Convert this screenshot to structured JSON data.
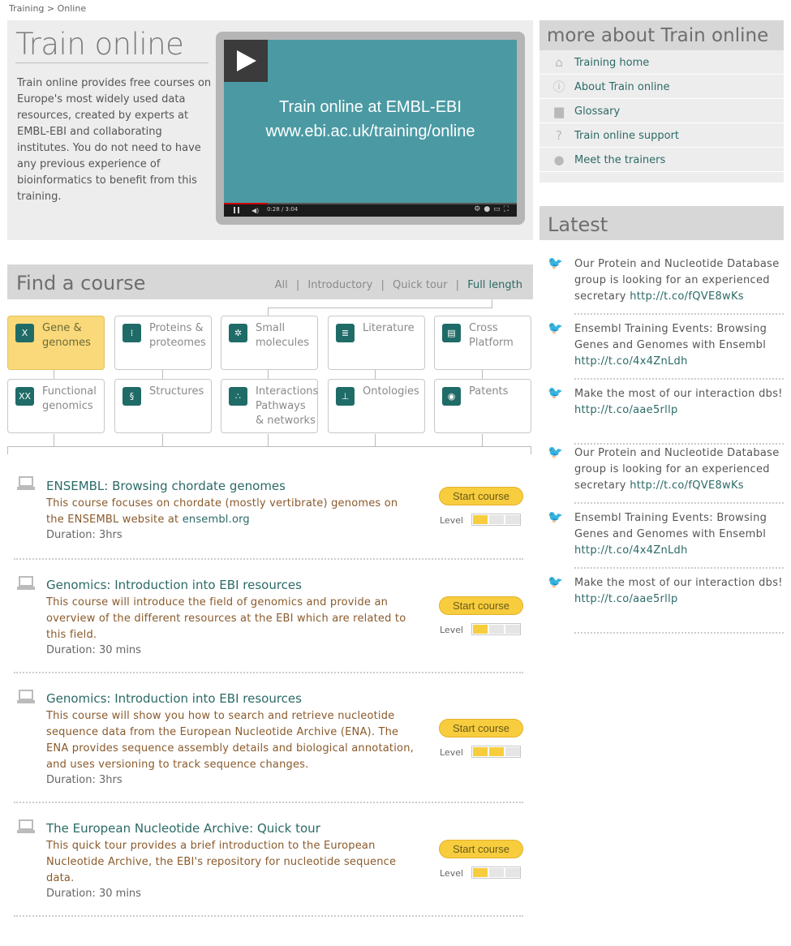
{
  "breadcrumb": {
    "part1": "Training",
    "sep": ">",
    "part2": "Online"
  },
  "hero": {
    "title": "Train online",
    "text": "Train online provides free courses on Europe's most widely used data resources, created by experts at EMBL-EBI and collaborating institutes. You do not need to have any previous experience of bioinformatics to benefit from this training.",
    "video": {
      "line1": "Train online at EMBL-EBI",
      "line2": "www.ebi.ac.uk/training/online",
      "time": "0:28 / 3:04",
      "progress": 0.15
    }
  },
  "more": {
    "title": "more about Train online",
    "items": [
      {
        "label": "Training home",
        "icon": "home-icon"
      },
      {
        "label": "About Train online",
        "icon": "info-icon"
      },
      {
        "label": "Glossary",
        "icon": "book-icon"
      },
      {
        "label": "Train online support",
        "icon": "question-icon"
      },
      {
        "label": "Meet the trainers",
        "icon": "speech-icon"
      }
    ]
  },
  "latest": {
    "title": "Latest",
    "tweets": [
      {
        "text": "Our Protein and Nucleotide Database group is looking for an experienced secretary",
        "link": "http://t.co/fQVE8wKs"
      },
      {
        "text": "Ensembl Training Events: Browsing Genes and Genomes with Ensembl",
        "link": "http://t.co/4x4ZnLdh"
      },
      {
        "text": "Make the most of our interaction dbs!",
        "link": "http://t.co/aae5rllp"
      },
      {
        "text": "Our Protein and Nucleotide Database group is looking for an experienced secretary",
        "link": "http://t.co/fQVE8wKs"
      },
      {
        "text": "Ensembl Training Events: Browsing Genes and Genomes with Ensembl",
        "link": "http://t.co/4x4ZnLdh"
      },
      {
        "text": "Make the most of our interaction dbs!",
        "link": "http://t.co/aae5rllp"
      }
    ]
  },
  "find": {
    "title": "Find a course",
    "filters": [
      "All",
      "Introductory",
      "Quick tour",
      "Full length"
    ],
    "filter_sep": "|",
    "categories": [
      {
        "label": "Gene & genomes",
        "icon": "dna-icon",
        "selected": true
      },
      {
        "label": "Proteins & proteomes",
        "icon": "protein-icon",
        "selected": false
      },
      {
        "label": "Small molecules",
        "icon": "molecule-icon",
        "selected": false
      },
      {
        "label": "Literature",
        "icon": "document-icon",
        "selected": false
      },
      {
        "label": "Cross Platform",
        "icon": "platform-icon",
        "selected": false
      },
      {
        "label": "Functional genomics",
        "icon": "chromosome-icon",
        "selected": false
      },
      {
        "label": "Structures",
        "icon": "structure-icon",
        "selected": false
      },
      {
        "label": "Interactions Pathways & networks",
        "icon": "network-icon",
        "selected": false
      },
      {
        "label": "Ontologies",
        "icon": "hierarchy-icon",
        "selected": false
      },
      {
        "label": "Patents",
        "icon": "patent-icon",
        "selected": false
      }
    ]
  },
  "courses": [
    {
      "title": "ENSEMBL: Browsing chordate genomes",
      "desc": "This course focuses on chordate (mostly vertibrate) genomes on the ENSEMBL website at",
      "link": "ensembl.org",
      "duration": "Duration: 3hrs",
      "start": "Start course",
      "level_label": "Level",
      "level": 1
    },
    {
      "title": "Genomics: Introduction into EBI resources",
      "desc": "This course will introduce the field of genomics and provide an overview of the different resources at the EBI which are related to this field.",
      "link": "",
      "duration": "Duration: 30 mins",
      "start": "Start course",
      "level_label": "Level",
      "level": 1
    },
    {
      "title": "Genomics: Introduction into EBI resources",
      "desc": "This course will show you how to search and retrieve nucleotide sequence data from the European Nucleotide Archive (ENA). The ENA provides sequence assembly details and biological annotation, and uses versioning to track sequence changes.",
      "link": "",
      "duration": "Duration: 3hrs",
      "start": "Start course",
      "level_label": "Level",
      "level": 2
    },
    {
      "title": "The European Nucleotide Archive: Quick tour",
      "desc": "This quick tour provides a brief introduction to the European Nucleotide Archive, the EBI's repository for nucleotide sequence data.",
      "link": "",
      "duration": "Duration: 30 mins",
      "start": "Start course",
      "level_label": "Level",
      "level": 1
    }
  ]
}
